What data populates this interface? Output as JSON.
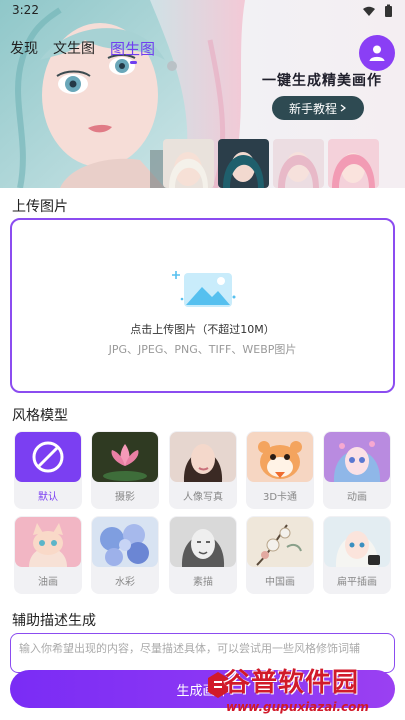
{
  "status_bar": {
    "time": "3:22",
    "icons": [
      "wifi-icon",
      "battery-icon"
    ]
  },
  "tabs": [
    {
      "label": "发现",
      "active": false
    },
    {
      "label": "文生图",
      "active": false
    },
    {
      "label": "图生图",
      "active": true
    }
  ],
  "banner": {
    "slogan": "一键生成精美画作",
    "tutorial_label": "新手教程",
    "thumbnails": [
      "portrait-white-hair",
      "portrait-dark-teal-hair",
      "portrait-pink-hair",
      "portrait-pink-curls"
    ]
  },
  "upload": {
    "section_title": "上传图片",
    "prompt": "点击上传图片（不超过10M）",
    "formats": "JPG、JPEG、PNG、TIFF、WEBP图片"
  },
  "styles": {
    "section_title": "风格模型",
    "items": [
      {
        "label": "默认",
        "selected": true,
        "thumb": "ban-icon"
      },
      {
        "label": "摄影",
        "selected": false,
        "thumb": "lotus"
      },
      {
        "label": "人像写真",
        "selected": false,
        "thumb": "portrait"
      },
      {
        "label": "3D卡通",
        "selected": false,
        "thumb": "hamster"
      },
      {
        "label": "动画",
        "selected": false,
        "thumb": "anime-girl"
      },
      {
        "label": "油画",
        "selected": false,
        "thumb": "cat"
      },
      {
        "label": "水彩",
        "selected": false,
        "thumb": "hydrangea"
      },
      {
        "label": "素描",
        "selected": false,
        "thumb": "sketch-woman"
      },
      {
        "label": "中国画",
        "selected": false,
        "thumb": "ink-flowers"
      },
      {
        "label": "扁平插画",
        "selected": false,
        "thumb": "flat-girl"
      }
    ]
  },
  "assist": {
    "section_title": "辅助描述生成",
    "placeholder": "输入你希望出现的内容，尽量描述具体，可以尝试用一些风格修饰词辅"
  },
  "generate_label": "生成画作",
  "watermark": {
    "title": "谷普软件园",
    "url": "www.gupuxiazai.com"
  },
  "colors": {
    "accent": "#8b4cf0",
    "button": "#7a2cf5",
    "watermark": "#d11a2a"
  }
}
